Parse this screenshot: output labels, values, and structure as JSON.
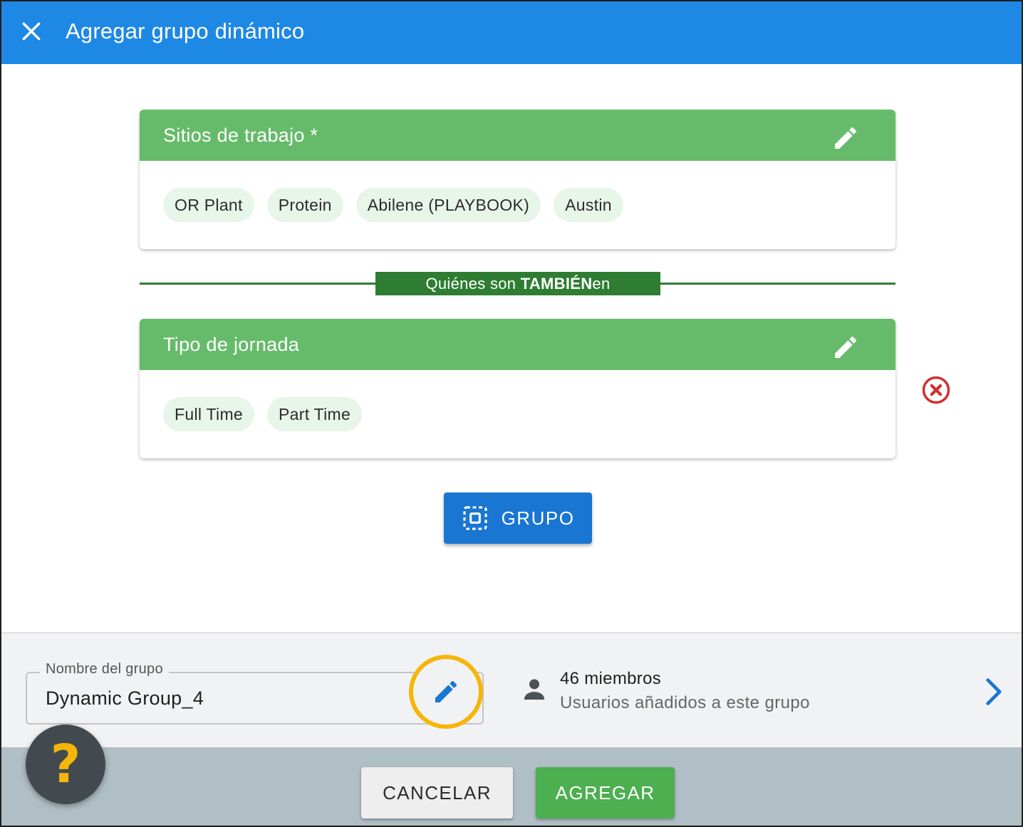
{
  "window": {
    "title": "Agregar grupo dinámico"
  },
  "cards": [
    {
      "title": "Sitios de trabajo *",
      "chips": [
        "OR Plant",
        "Protein",
        "Abilene (PLAYBOOK)",
        "Austin"
      ]
    },
    {
      "title": "Tipo de jornada",
      "chips": [
        "Full Time",
        "Part Time"
      ]
    }
  ],
  "connector": {
    "prefix": "Quiénes son ",
    "emphasis": "TAMBIÉN",
    "suffix": "en"
  },
  "group_button": {
    "label": "GRUPO"
  },
  "footer": {
    "name_label": "Nombre del grupo",
    "name_value": "Dynamic Group_4",
    "members_count": "46 miembros",
    "members_sub": "Usuarios añadidos a este grupo"
  },
  "actions": {
    "cancel": "CANCELAR",
    "add": "AGREGAR"
  },
  "help": {
    "glyph": "?"
  },
  "colors": {
    "header": "#1e88e5",
    "card_header": "#66bb6a",
    "connector": "#2e7d32",
    "primary_button": "#1976d2",
    "add_button": "#4caf50",
    "highlight_ring": "#f5b50a",
    "remove_icon": "#d32f2f"
  }
}
